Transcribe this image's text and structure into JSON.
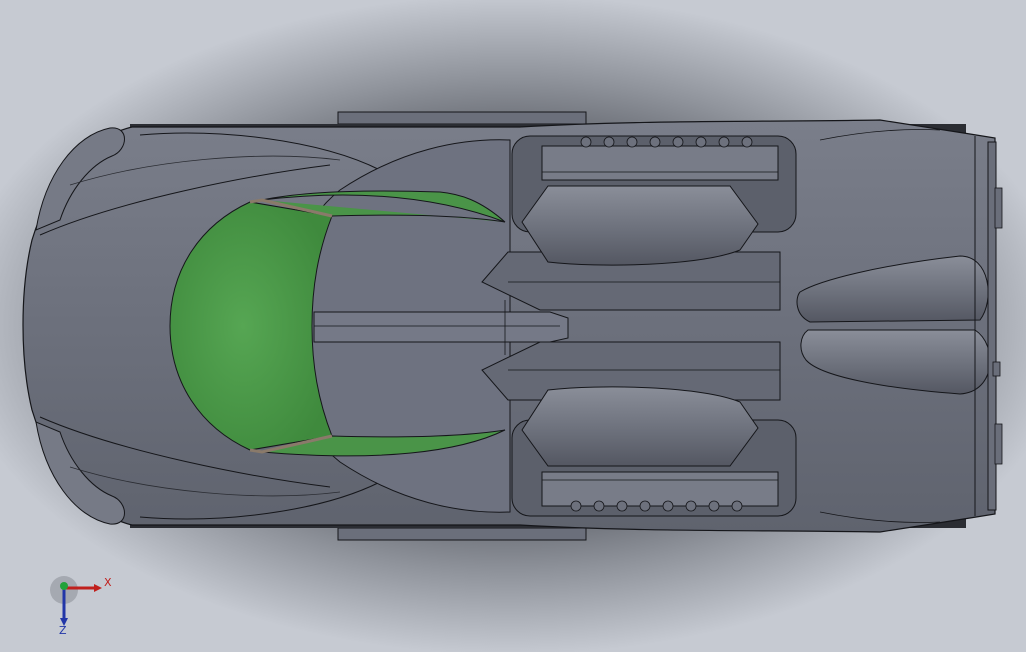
{
  "viewport": {
    "background_color": "#c7cbd3",
    "model_color": "#6f7380",
    "glass_color": "#4a9448",
    "outline_color": "#15161a"
  },
  "triad": {
    "x_label": "X",
    "z_label": "Z",
    "x_color": "#c0201d",
    "y_color": "#23a23a",
    "z_color": "#2236a8"
  }
}
